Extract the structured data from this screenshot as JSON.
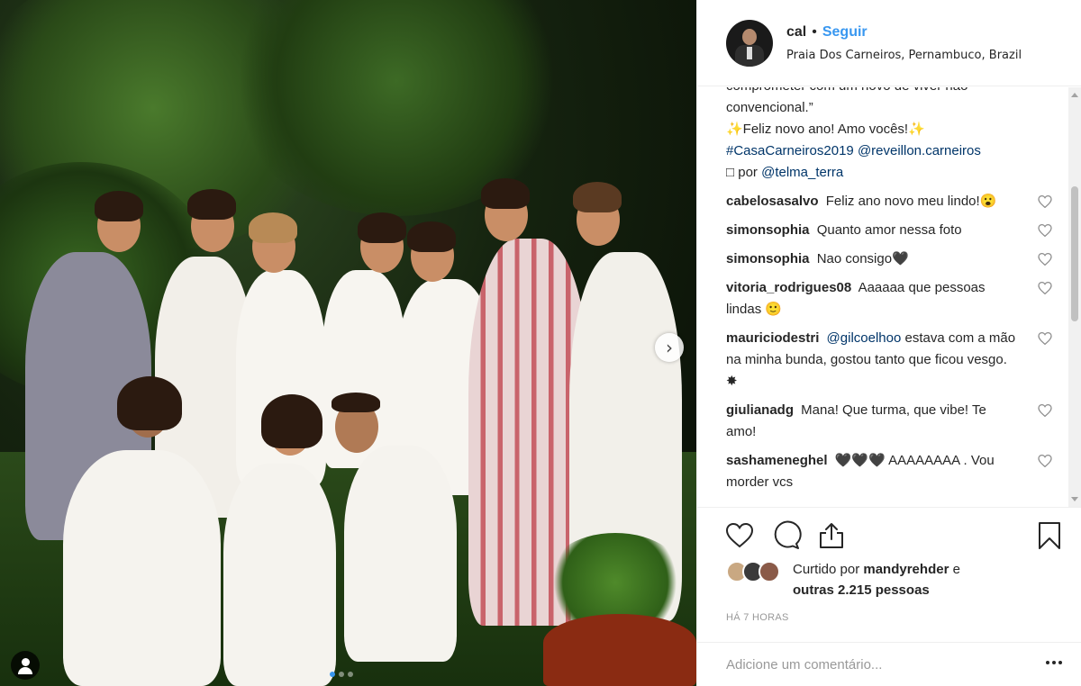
{
  "header": {
    "username": "cal",
    "separator": "•",
    "follow_label": "Seguir",
    "location": "Praia Dos Carneiros, Pernambuco, Brazil"
  },
  "caption": {
    "cut_line": "comprometer com um novo de viver não",
    "line1": "convencional.”",
    "line2": "✨Feliz novo ano! Amo vocês!✨",
    "hashtag": "#CasaCarneiros2019",
    "mention": "@reveillon.carneiros",
    "photo_credit_prefix": "□ por",
    "photo_credit_user": "@telma_terra"
  },
  "comments": [
    {
      "user": "cabelosasalvo",
      "text": "Feliz ano novo meu lindo!😮"
    },
    {
      "user": "simonsophia",
      "text": "Quanto amor nessa foto"
    },
    {
      "user": "simonsophia",
      "text": "Nao consigo🖤"
    },
    {
      "user": "vitoria_rodrigues08",
      "text": "Aaaaaa que pessoas lindas 🙂"
    },
    {
      "user": "mauriciodestri",
      "mention": "@gilcoelhoo",
      "text": "estava com a mão na minha bunda, gostou tanto que ficou vesgo. ✸"
    },
    {
      "user": "giulianadg",
      "text": "Mana! Que turma, que vibe! Te amo!"
    },
    {
      "user": "sashameneghel",
      "text": "🖤🖤🖤 AAAAAAAA . Vou morder vcs"
    }
  ],
  "likes": {
    "prefix": "Curtido por",
    "user": "mandyrehder",
    "connector": "e",
    "others": "outras 2.215 pessoas"
  },
  "timestamp": "HÁ 7 HORAS",
  "add_comment": {
    "placeholder": "Adicione um comentário..."
  },
  "carousel": {
    "slide_count": 3,
    "active_index": 0
  },
  "colors": {
    "link": "#003569",
    "follow": "#3897f0",
    "muted": "#999999",
    "border": "#efefef"
  },
  "icons": [
    "heart-icon",
    "comment-icon",
    "share-icon",
    "bookmark-icon",
    "more-options-icon",
    "chevron-right-icon",
    "user-tag-icon"
  ]
}
